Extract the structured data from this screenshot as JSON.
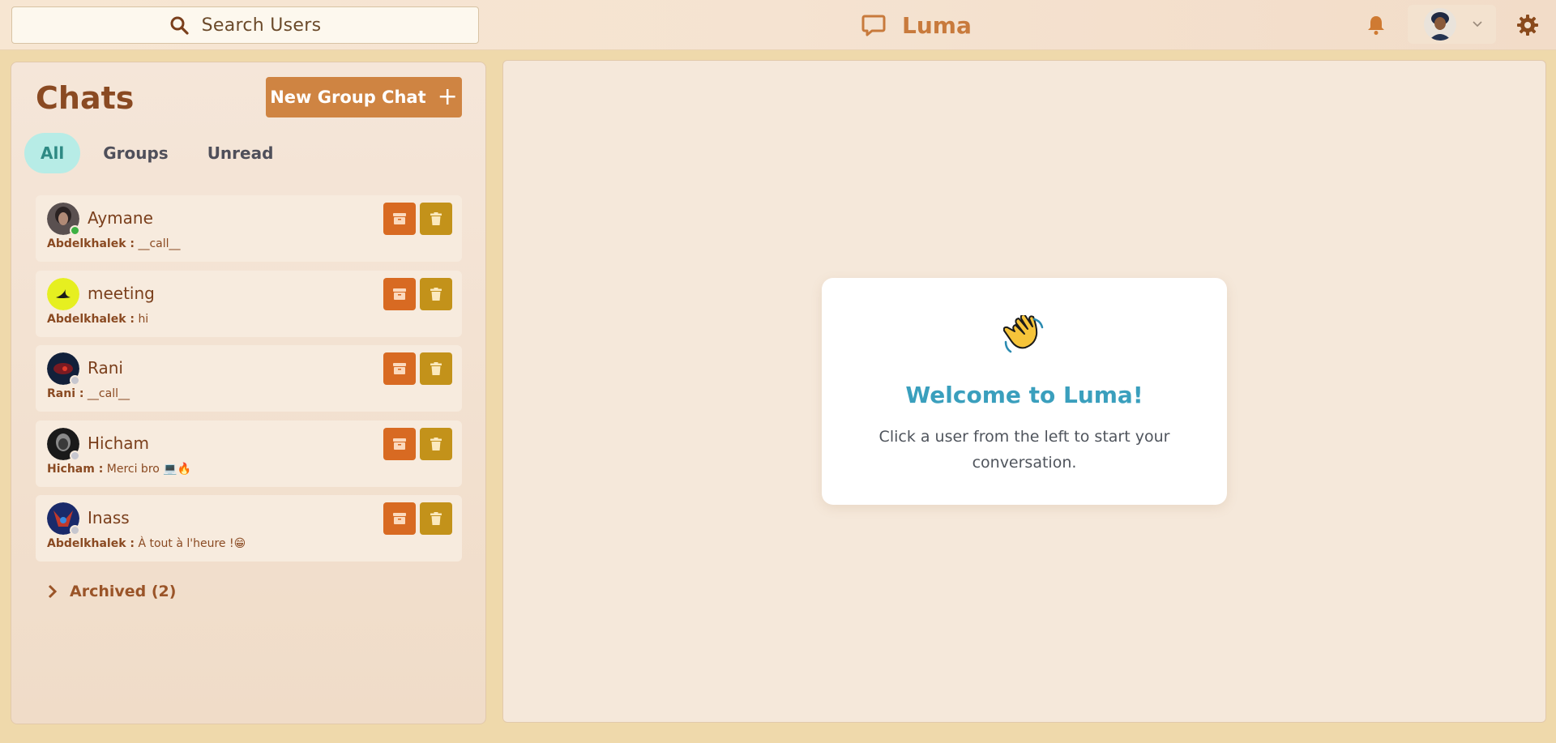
{
  "header": {
    "search_label": "Search Users",
    "brand_name": "Luma"
  },
  "sidebar": {
    "title": "Chats",
    "new_group_label": "New Group Chat",
    "new_group_icon": "+",
    "tabs": [
      {
        "label": "All",
        "active": true
      },
      {
        "label": "Groups",
        "active": false
      },
      {
        "label": "Unread",
        "active": false
      }
    ],
    "chats": [
      {
        "name": "Aymane",
        "sender": "Abdelkhalek :",
        "message": "__call__",
        "status": "online",
        "status_color": "#3cb043"
      },
      {
        "name": "meeting",
        "sender": "Abdelkhalek :",
        "message": "hi",
        "status": "none",
        "status_color": ""
      },
      {
        "name": "Rani",
        "sender": "Rani :",
        "message": "__call__",
        "status": "offline",
        "status_color": "#c7c7cf"
      },
      {
        "name": "Hicham",
        "sender": "Hicham :",
        "message": "Merci bro 💻🔥",
        "status": "offline",
        "status_color": "#c7c7cf"
      },
      {
        "name": "Inass",
        "sender": "Abdelkhalek :",
        "message": "À tout à l'heure !😁",
        "status": "offline",
        "status_color": "#c7c7cf"
      }
    ],
    "archived_label": "Archived (2)"
  },
  "welcome": {
    "emoji": "👋",
    "title": "Welcome to Luma!",
    "subtitle": "Click a user from the left to start your conversation."
  },
  "colors": {
    "accent": "#cf8442",
    "archive": "#d86a22",
    "delete": "#c3921a",
    "welcome_title": "#3a9fbd",
    "active_tab_bg": "#b7ece6"
  }
}
